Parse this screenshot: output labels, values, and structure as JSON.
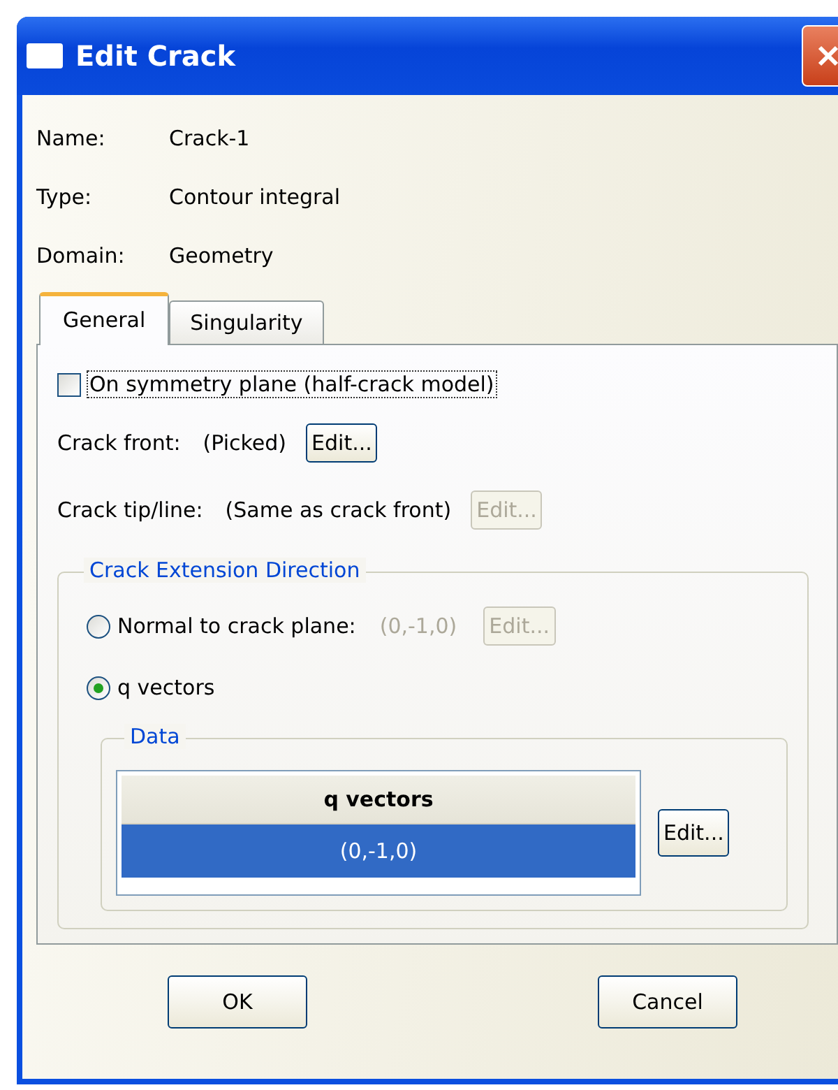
{
  "window": {
    "title": "Edit Crack"
  },
  "info": [
    {
      "label": "Name:",
      "value": "Crack-1"
    },
    {
      "label": "Type:",
      "value": "Contour integral"
    },
    {
      "label": "Domain:",
      "value": "Geometry"
    }
  ],
  "tabs": [
    {
      "label": "General",
      "selected": true
    },
    {
      "label": "Singularity",
      "selected": false
    }
  ],
  "symmetry_checkbox": {
    "label": "On symmetry plane (half-crack model)",
    "checked": false,
    "focused": true
  },
  "fields": [
    {
      "label": "Crack front:",
      "value": "(Picked)",
      "button": {
        "label": "Edit...",
        "disabled": false
      }
    },
    {
      "label": "Crack tip/line:",
      "value": "(Same as crack front)",
      "button": {
        "label": "Edit...",
        "disabled": true
      }
    }
  ],
  "extension_direction": {
    "title": "Crack Extension Direction",
    "options": [
      {
        "label": "Normal to crack plane:",
        "value": "(0,-1,0)",
        "selected": false,
        "button": {
          "label": "Edit...",
          "disabled": true
        }
      },
      {
        "label": "q vectors",
        "selected": true
      }
    ]
  },
  "data_group": {
    "title": "Data",
    "table": {
      "columns": [
        "q vectors"
      ],
      "rows": [
        {
          "cells": [
            "(0,-1,0)"
          ],
          "selected": true
        }
      ]
    },
    "button": {
      "label": "Edit...",
      "disabled": false
    }
  },
  "buttons": [
    {
      "label": "OK"
    },
    {
      "label": "Cancel"
    }
  ]
}
